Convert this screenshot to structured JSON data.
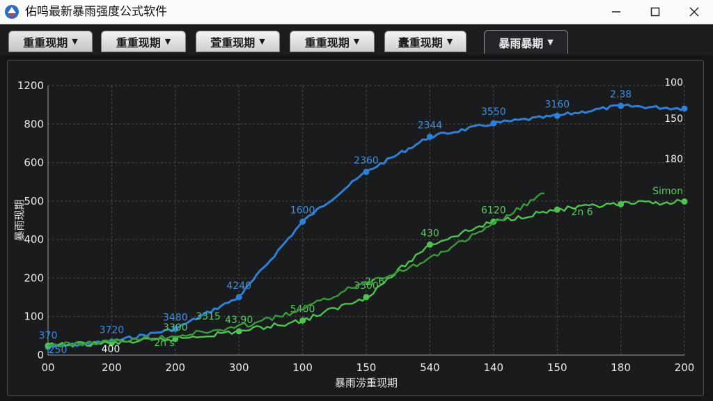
{
  "window": {
    "title": "佑鸣最新暴雨强度公式软件",
    "controls": [
      "minimize-icon",
      "maximize-icon",
      "close-icon"
    ]
  },
  "tabs": [
    {
      "label": "重重现期"
    },
    {
      "label": "重重现期"
    },
    {
      "label": "萓重现期"
    },
    {
      "label": "重重现期"
    },
    {
      "label": "蠹重现期"
    },
    {
      "label": "暴雨暴期"
    }
  ],
  "colors": {
    "blue": "#2f7fd6",
    "green_bright": "#4fc34f",
    "green_dark": "#3a9a3a",
    "grid": "#4b4d52"
  },
  "chart_data": {
    "type": "line",
    "xlabel": "暴雨涝重现期",
    "ylabel": "暴雨现期",
    "x_tick_labels": [
      "00",
      "200",
      "200",
      "300",
      "100",
      "150",
      "540",
      "140",
      "150",
      "180",
      "200"
    ],
    "y_tick_labels": [
      "0",
      "100",
      "200",
      "400",
      "500",
      "600",
      "800",
      "1200"
    ],
    "right_axis_labels": [
      "100",
      "150",
      "180"
    ],
    "grid": true,
    "series": [
      {
        "color": "blue",
        "points": [
          0,
          1,
          2,
          3,
          4,
          5,
          6,
          7,
          8,
          9,
          10
        ],
        "values": [
          30,
          50,
          97,
          215,
          495,
          680,
          810,
          860,
          888,
          925,
          915
        ],
        "point_labels": [
          "370",
          "3720",
          "3480",
          "4240",
          "1600",
          "2360",
          "2344",
          "3550",
          "3160",
          "2.38",
          ""
        ]
      },
      {
        "color": "green_bright",
        "points": [
          0,
          1,
          2,
          3,
          4,
          5,
          6,
          7,
          8,
          9,
          10
        ],
        "values": [
          35,
          45,
          60,
          88,
          128,
          215,
          410,
          495,
          540,
          560,
          570
        ],
        "point_labels": [
          "",
          "",
          "3300",
          "43.90",
          "5400",
          "3300",
          "430",
          "6120",
          "",
          "",
          ""
        ]
      },
      {
        "color": "green_dark",
        "points": [
          0,
          1,
          2,
          3,
          4,
          5,
          6,
          7,
          8
        ],
        "values": [
          35,
          50,
          70,
          100,
          160,
          260,
          340,
          460,
          600
        ],
        "point_labels": []
      }
    ],
    "annotations": [
      {
        "text": "250",
        "color": "blue"
      },
      {
        "text": "400",
        "color": "white"
      },
      {
        "text": "2n s",
        "color": "green"
      },
      {
        "text": "3315",
        "color": "green"
      },
      {
        "text": "2r 6",
        "color": "green"
      },
      {
        "text": "2n 6",
        "color": "green"
      },
      {
        "text": "Simon",
        "color": "green"
      }
    ]
  }
}
